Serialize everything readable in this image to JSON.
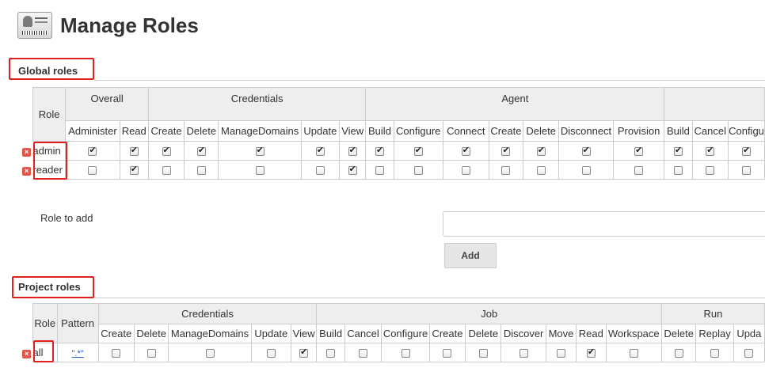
{
  "page": {
    "title": "Manage Roles"
  },
  "global_roles": {
    "heading": "Global roles",
    "role_header": "Role",
    "groups": [
      {
        "name": "Overall",
        "perms": [
          "Administer",
          "Read"
        ]
      },
      {
        "name": "Credentials",
        "perms": [
          "Create",
          "Delete",
          "ManageDomains",
          "Update",
          "View"
        ]
      },
      {
        "name": "Agent",
        "perms": [
          "Build",
          "Configure",
          "Connect",
          "Create",
          "Delete",
          "Disconnect",
          "Provision"
        ]
      },
      {
        "name": "",
        "perms": [
          "Build",
          "Cancel",
          "Configu"
        ]
      }
    ],
    "rows": [
      {
        "role": "admin",
        "checks": [
          1,
          1,
          1,
          1,
          1,
          1,
          1,
          1,
          1,
          1,
          1,
          1,
          1,
          1,
          1,
          1,
          1
        ]
      },
      {
        "role": "reader",
        "checks": [
          0,
          1,
          0,
          0,
          0,
          0,
          1,
          0,
          0,
          0,
          0,
          0,
          0,
          0,
          0,
          0,
          0
        ]
      }
    ]
  },
  "add_role": {
    "label": "Role to add",
    "value": "",
    "button": "Add"
  },
  "project_roles": {
    "heading": "Project roles",
    "role_header": "Role",
    "pattern_header": "Pattern",
    "groups": [
      {
        "name": "Credentials",
        "perms": [
          "Create",
          "Delete",
          "ManageDomains",
          "Update",
          "View"
        ]
      },
      {
        "name": "Job",
        "perms": [
          "Build",
          "Cancel",
          "Configure",
          "Create",
          "Delete",
          "Discover",
          "Move",
          "Read",
          "Workspace"
        ]
      },
      {
        "name": "Run",
        "perms": [
          "Delete",
          "Replay",
          "Upda"
        ]
      }
    ],
    "rows": [
      {
        "role": "all",
        "pattern": "\".*\"",
        "checks": [
          0,
          0,
          0,
          0,
          1,
          0,
          0,
          0,
          0,
          0,
          0,
          0,
          1,
          0,
          0,
          0,
          0
        ]
      }
    ]
  },
  "icons": {
    "header_icon": "id-card-icon",
    "delete_icon": "delete-icon"
  },
  "colors": {
    "highlight": "#e0201c",
    "header_bg": "#eeeeee",
    "link": "#2255cc"
  }
}
